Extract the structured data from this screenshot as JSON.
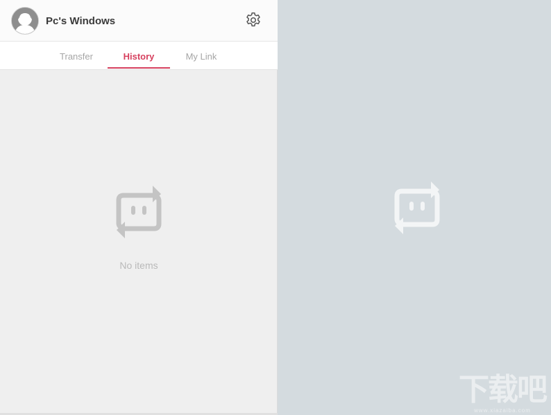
{
  "header": {
    "device_name": "Pc's Windows",
    "avatar_icon": "user-silhouette-icon",
    "settings_icon": "gear-icon"
  },
  "tabs": [
    {
      "label": "Transfer",
      "active": false
    },
    {
      "label": "History",
      "active": true
    },
    {
      "label": "My Link",
      "active": false
    }
  ],
  "history": {
    "empty_text": "No items",
    "empty_icon": "send-anywhere-logo-icon"
  },
  "preview": {
    "logo_icon": "send-anywhere-logo-icon"
  },
  "watermark": {
    "text": "下载吧",
    "subtext": "www.xiazaiba.com"
  },
  "colors": {
    "accent": "#d6405e",
    "left_bg": "#efefef",
    "right_bg": "#d4dbdf"
  }
}
